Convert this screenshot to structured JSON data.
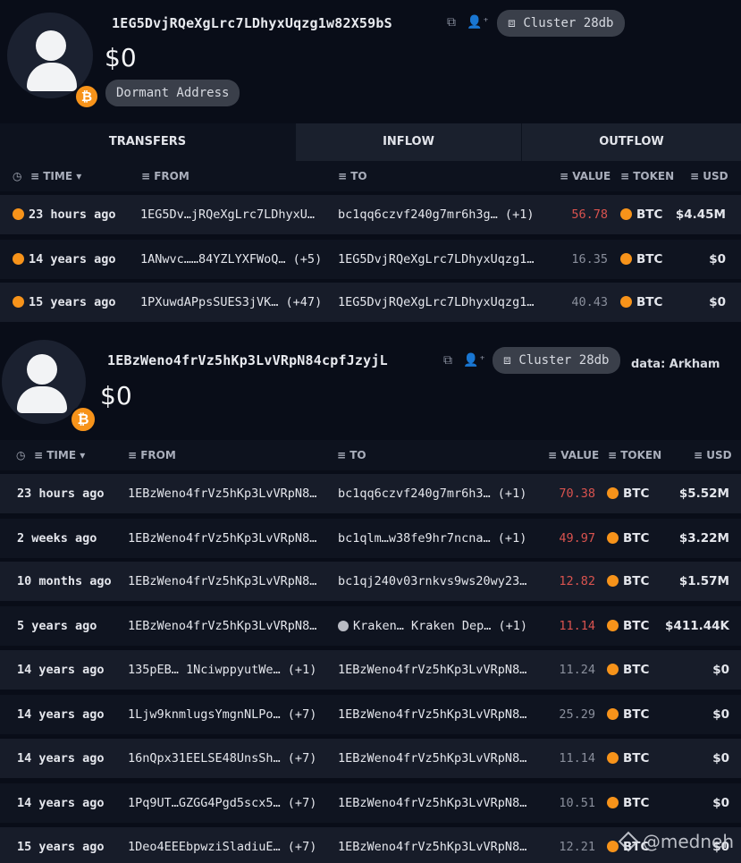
{
  "panel1": {
    "address": "1EG5DvjRQeXgLrc7LDhyxUqzg1w82X59bS",
    "balance": "$0",
    "cluster_label": "Cluster 28db",
    "tag": "Dormant Address",
    "tabs": [
      "TRANSFERS",
      "INFLOW",
      "OUTFLOW"
    ],
    "active_tab": "TRANSFERS",
    "columns": {
      "time": "TIME",
      "from": "FROM",
      "to": "TO",
      "value": "VALUE",
      "token": "TOKEN",
      "usd": "USD"
    },
    "rows": [
      {
        "time": "23 hours ago",
        "from": "1EG5Dv…jRQeXgLrc7LDhyxU…",
        "to": "bc1qq6czvf240g7mr6h3g…  (+1)",
        "value": "56.78",
        "token": "BTC",
        "usd": "$4.45M",
        "value_color": "red"
      },
      {
        "time": "14 years ago",
        "from": "1ANwvc……84YZLYXFWoQ…  (+5)",
        "to": "1EG5DvjRQeXgLrc7LDhyxUqzg1…",
        "value": "16.35",
        "token": "BTC",
        "usd": "$0",
        "value_color": "grey"
      },
      {
        "time": "15 years ago",
        "from": "1PXuwdAPpsSUES3jVK…  (+47)",
        "to": "1EG5DvjRQeXgLrc7LDhyxUqzg1…",
        "value": "40.43",
        "token": "BTC",
        "usd": "$0",
        "value_color": "grey"
      }
    ]
  },
  "panel2": {
    "address": "1EBzWeno4frVz5hKp3LvVRpN84cpfJzyjL",
    "balance": "$0",
    "cluster_label": "Cluster 28db",
    "credit": "data: Arkham",
    "columns": {
      "time": "TIME",
      "from": "FROM",
      "to": "TO",
      "value": "VALUE",
      "token": "TOKEN",
      "usd": "USD"
    },
    "rows": [
      {
        "time": "23 hours ago",
        "from": "1EBzWeno4frVz5hKp3LvVRpN8…",
        "to": "bc1qq6czvf240g7mr6h3…  (+1)",
        "value": "70.38",
        "token": "BTC",
        "usd": "$5.52M",
        "value_color": "red"
      },
      {
        "time": "2 weeks ago",
        "from": "1EBzWeno4frVz5hKp3LvVRpN8…",
        "to": "bc1qlm…w38fe9hr7ncna…  (+1)",
        "value": "49.97",
        "token": "BTC",
        "usd": "$3.22M",
        "value_color": "red"
      },
      {
        "time": "10 months ago",
        "from": "1EBzWeno4frVz5hKp3LvVRpN8…",
        "to": "bc1qj240v03rnkvs9ws20wy23…",
        "value": "12.82",
        "token": "BTC",
        "usd": "$1.57M",
        "value_color": "red"
      },
      {
        "time": "5 years ago",
        "from": "1EBzWeno4frVz5hKp3LvVRpN8…",
        "to": "Kraken…  Kraken Dep…  (+1)",
        "value": "11.14",
        "token": "BTC",
        "usd": "$411.44K",
        "value_color": "red",
        "to_entity": "kraken"
      },
      {
        "time": "14 years ago",
        "from": "135pEB…  1NciwppyutWe…  (+1)",
        "to": "1EBzWeno4frVz5hKp3LvVRpN8…",
        "value": "11.24",
        "token": "BTC",
        "usd": "$0",
        "value_color": "grey"
      },
      {
        "time": "14 years ago",
        "from": "1Ljw9knmlugsYmgnNLPo…  (+7)",
        "to": "1EBzWeno4frVz5hKp3LvVRpN8…",
        "value": "25.29",
        "token": "BTC",
        "usd": "$0",
        "value_color": "grey"
      },
      {
        "time": "14 years ago",
        "from": "16nQpx31EELSE48UnsSh…  (+7)",
        "to": "1EBzWeno4frVz5hKp3LvVRpN8…",
        "value": "11.14",
        "token": "BTC",
        "usd": "$0",
        "value_color": "grey"
      },
      {
        "time": "14 years ago",
        "from": "1Pq9UT…GZGG4Pgd5scx5…  (+7)",
        "to": "1EBzWeno4frVz5hKp3LvVRpN8…",
        "value": "10.51",
        "token": "BTC",
        "usd": "$0",
        "value_color": "grey"
      },
      {
        "time": "15 years ago",
        "from": "1Deo4EEEbpwziSladiuE…  (+7)",
        "to": "1EBzWeno4frVz5hKp3LvVRpN8…",
        "value": "12.21",
        "token": "BTC",
        "usd": "$0",
        "value_color": "grey"
      }
    ]
  },
  "watermark": "@medneh",
  "colors": {
    "btc_orange": "#f7931a",
    "value_red": "#d9534f",
    "value_grey": "#8a8f9c",
    "background": "#090d18"
  },
  "icons": [
    "user-avatar-icon",
    "bitcoin-icon",
    "copy-icon",
    "add-user-icon",
    "cluster-icon",
    "clock-icon",
    "filter-icon",
    "sort-down-icon",
    "kraken-icon"
  ]
}
